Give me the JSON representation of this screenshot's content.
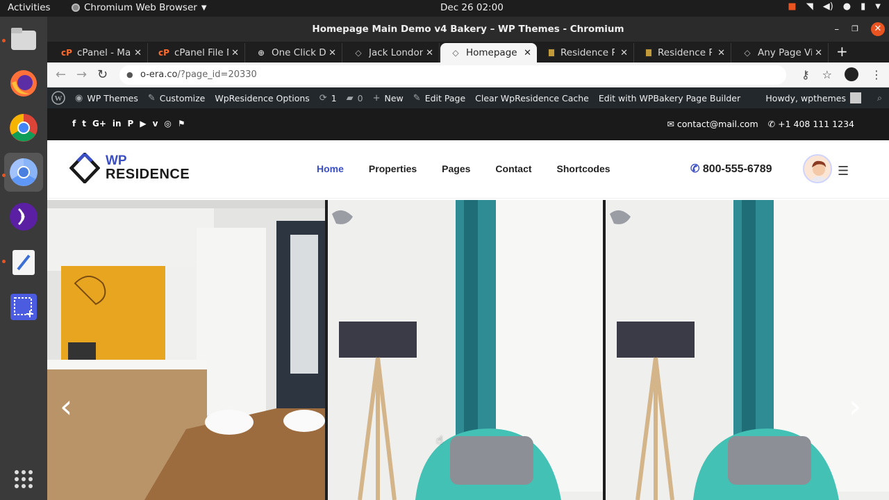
{
  "topbar": {
    "activities": "Activities",
    "app_name": "Chromium Web Browser",
    "clock": "Dec 26  02:00"
  },
  "window": {
    "title": "Homepage Main Demo v4 Bakery – WP Themes - Chromium"
  },
  "tabs": [
    {
      "label": "cPanel - Mai",
      "icon": "cpanel-icon"
    },
    {
      "label": "cPanel File M",
      "icon": "cpanel-icon"
    },
    {
      "label": "One Click De",
      "icon": "globe-icon"
    },
    {
      "label": "Jack London",
      "icon": "diamond-icon"
    },
    {
      "label": "Homepage M",
      "icon": "diamond-icon"
    },
    {
      "label": "Residence R",
      "icon": "residence-icon"
    },
    {
      "label": "Residence R",
      "icon": "residence-icon"
    },
    {
      "label": "Any Page Vi",
      "icon": "diamond-icon"
    }
  ],
  "address": {
    "host": "o-era.co",
    "path": "/?page_id=20330"
  },
  "adminbar": {
    "wp_themes": "WP Themes",
    "customize": "Customize",
    "options": "WpResidence Options",
    "updates": "1",
    "comments": "0",
    "new": "New",
    "edit_page": "Edit Page",
    "clear_cache": "Clear WpResidence Cache",
    "wpbakery": "Edit with WPBakery Page Builder",
    "howdy": "Howdy, wpthemes"
  },
  "socialbar": {
    "email": "contact@mail.com",
    "phone": "+1 408 111 1234"
  },
  "site": {
    "logo_top": "WP",
    "logo_bottom": "RESIDENCE",
    "nav": [
      "Home",
      "Properties",
      "Pages",
      "Contact",
      "Shortcodes"
    ],
    "phone": "800-555-6789"
  },
  "colors": {
    "accent": "#3a4fc4",
    "ubuntu_orange": "#e95420",
    "admin_bar": "#23282d"
  }
}
